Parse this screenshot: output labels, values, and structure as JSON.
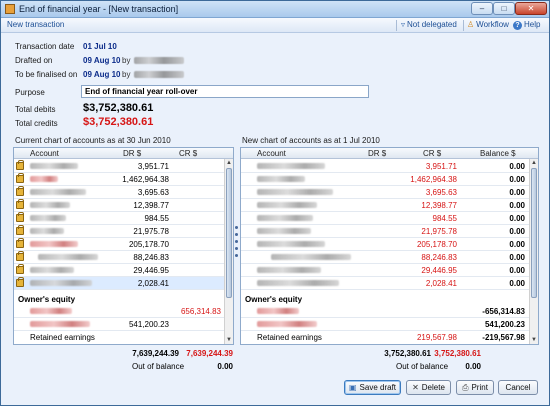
{
  "window": {
    "title": "End of financial year - [New transaction]"
  },
  "toolbar": {
    "tab": "New transaction",
    "delegation": "Not delegated",
    "workflow": "Workflow",
    "help": "Help"
  },
  "form": {
    "transaction_date_label": "Transaction date",
    "transaction_date": "01 Jul 10",
    "drafted_on_label": "Drafted on",
    "drafted_on": "09 Aug 10",
    "finalised_label": "To be finalised on",
    "finalised_on": "09 Aug 10",
    "by": "by",
    "purpose_label": "Purpose",
    "purpose_value": "End of financial year roll-over",
    "total_debits_label": "Total debits",
    "total_debits": "$3,752,380.61",
    "total_credits_label": "Total credits",
    "total_credits": "$3,752,380.61"
  },
  "left_panel": {
    "title": "Current chart of accounts as at 30 Jun 2010",
    "col_account": "Account",
    "col_dr": "DR $",
    "col_cr": "CR $",
    "rows_dr": [
      "3,951.71",
      "1,462,964.38",
      "3,695.63",
      "12,398.77",
      "984.55",
      "21,975.78",
      "205,178.70",
      "88,246.83",
      "29,446.95",
      "2,028.41"
    ],
    "equity_section": "Owner's equity",
    "equity_cr": "656,314.83",
    "equity_dr": "541,200.23",
    "retained_label": "Retained earnings",
    "total_dr": "7,639,244.39",
    "total_cr": "7,639,244.39",
    "out_label": "Out of balance",
    "out_value": "0.00"
  },
  "right_panel": {
    "title": "New chart of accounts as at 1 Jul 2010",
    "col_account": "Account",
    "col_dr": "DR $",
    "col_cr": "CR $",
    "col_bal": "Balance $",
    "rows_cr": [
      "3,951.71",
      "1,462,964.38",
      "3,695.63",
      "12,398.77",
      "984.55",
      "21,975.78",
      "205,178.70",
      "88,246.83",
      "29,446.95",
      "2,028.41"
    ],
    "rows_bal": [
      "0.00",
      "0.00",
      "0.00",
      "0.00",
      "0.00",
      "0.00",
      "0.00",
      "0.00",
      "0.00",
      "0.00"
    ],
    "equity_section": "Owner's equity",
    "equity_bal_1": "-656,314.83",
    "equity_bal_2": "541,200.23",
    "retained_label": "Retained earnings",
    "retained_cr": "219,567.98",
    "retained_bal": "-219,567.98",
    "total_dr": "3,752,380.61",
    "total_cr": "3,752,380.61",
    "out_label": "Out of balance",
    "out_value": "0.00"
  },
  "buttons": {
    "save_draft": "Save draft",
    "delete": "Delete",
    "print": "Print",
    "cancel": "Cancel"
  },
  "colors": {
    "accent": "#1d4f95",
    "negative": "#d61515",
    "value": "#0c2c8a"
  }
}
